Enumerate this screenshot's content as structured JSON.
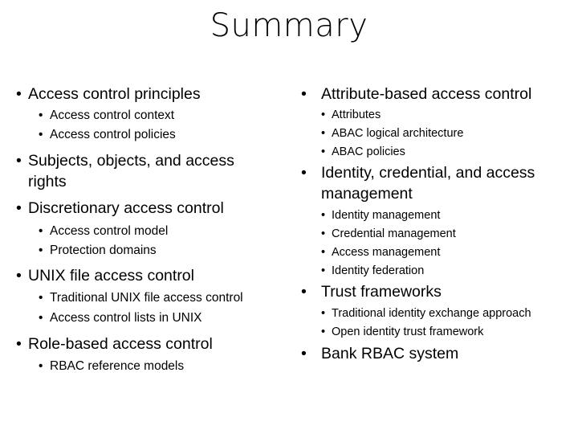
{
  "title": "Summary",
  "left": [
    {
      "level": 1,
      "text": "Access control principles"
    },
    {
      "level": 2,
      "text": "Access control context"
    },
    {
      "level": 2,
      "text": "Access control policies"
    },
    {
      "level": 1,
      "text": "Subjects, objects, and access"
    },
    {
      "level": 1,
      "text": "rights",
      "continuation": true
    },
    {
      "level": 1,
      "text": "Discretionary access control"
    },
    {
      "level": 2,
      "text": "Access control model"
    },
    {
      "level": 2,
      "text": "Protection domains"
    },
    {
      "level": 1,
      "text": "UNIX file access control"
    },
    {
      "level": 2,
      "text": "Traditional UNIX file access control"
    },
    {
      "level": 2,
      "text": "Access control lists in UNIX"
    },
    {
      "level": 1,
      "text": "Role-based access control"
    },
    {
      "level": 2,
      "text": "RBAC reference models"
    }
  ],
  "right": [
    {
      "level": 1,
      "text": "Attribute-based access control"
    },
    {
      "level": 2,
      "text": "Attributes"
    },
    {
      "level": 2,
      "text": "ABAC logical architecture"
    },
    {
      "level": 2,
      "text": "ABAC policies"
    },
    {
      "level": 1,
      "text": "Identity, credential, and access"
    },
    {
      "level": 1,
      "text": "management",
      "continuation": true
    },
    {
      "level": 2,
      "text": "Identity management"
    },
    {
      "level": 2,
      "text": "Credential management"
    },
    {
      "level": 2,
      "text": "Access management"
    },
    {
      "level": 2,
      "text": "Identity federation"
    },
    {
      "level": 1,
      "text": "Trust frameworks"
    },
    {
      "level": 2,
      "text": "Traditional identity exchange approach"
    },
    {
      "level": 2,
      "text": "Open identity trust framework"
    },
    {
      "level": 1,
      "text": "Bank RBAC system"
    }
  ],
  "bullet_glyph": "•"
}
